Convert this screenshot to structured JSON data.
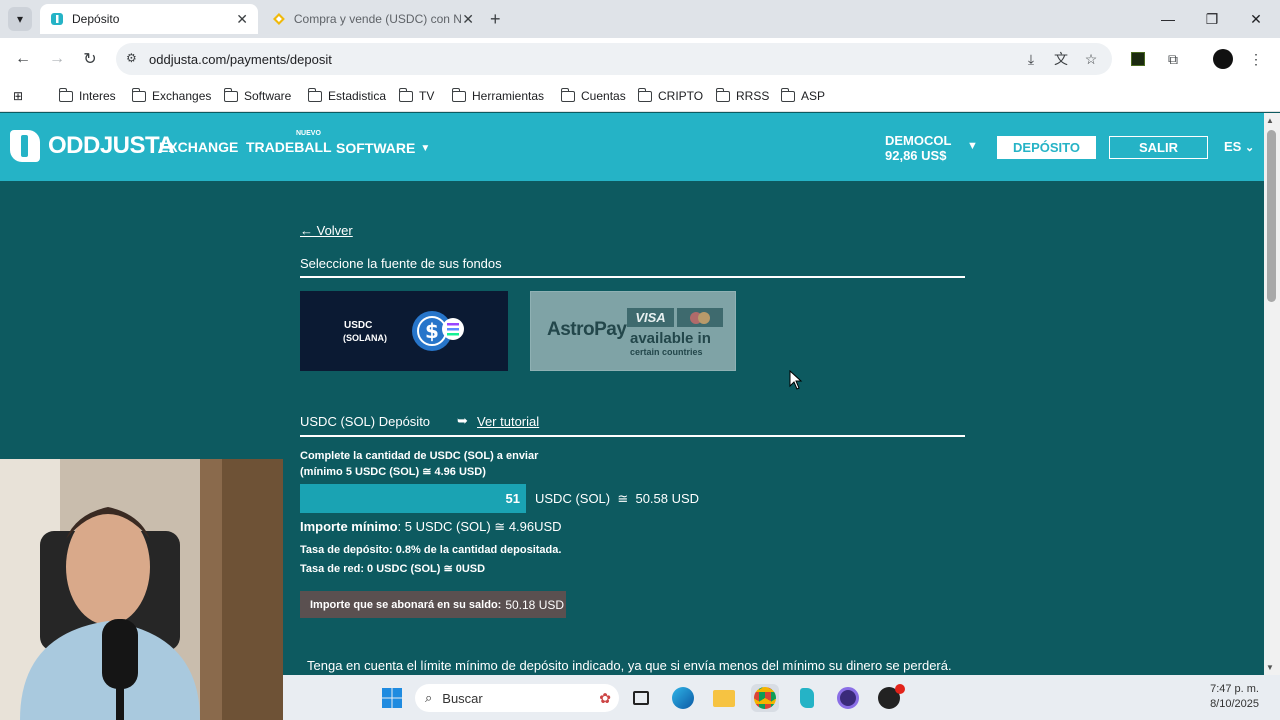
{
  "browser": {
    "tabs": [
      {
        "title": "Depósito"
      },
      {
        "title": "Compra y vende (USDC) con N..."
      }
    ],
    "url": "oddjusta.com/payments/deposit",
    "bookmarks": [
      "Interes",
      "Exchanges",
      "Software",
      "Estadistica",
      "TV",
      "Herramientas",
      "Cuentas",
      "CRIPTO",
      "RRSS",
      "ASP"
    ]
  },
  "header": {
    "logo": "ODDJUSTA",
    "nav": {
      "exchange": "EXCHANGE",
      "tradeball": "TRADEBALL",
      "new_badge": "NUEVO",
      "software": "SOFTWARE"
    },
    "account": {
      "name": "DEMOCOL",
      "balance": "92,86 US$"
    },
    "deposit_button": "DEPÓSITO",
    "logout_button": "SALIR",
    "language": "ES"
  },
  "content": {
    "back": "← Volver",
    "select_source": "Seleccione la fuente de sus fondos",
    "methods": {
      "usdc_line1": "USDC",
      "usdc_line2": "(SOLANA)",
      "astro_brand": "AstroPay",
      "astro_visa": "VISA",
      "astro_avail1": "available in",
      "astro_avail2": "certain countries"
    },
    "deposit_title": "USDC (SOL) Depósito",
    "tutorial_arrow": "➥",
    "tutorial_link": "Ver tutorial",
    "instruction_line1": "Complete la cantidad de USDC (SOL) a enviar",
    "instruction_line2": "(mínimo 5 USDC (SOL) ≅ 4.96 USD)",
    "amount_value": "51",
    "amount_conversion": "USDC (SOL)  ≅  50.58 USD",
    "min_label": "Importe mínimo",
    "min_value": ": 5 USDC (SOL) ≅ 4.96USD",
    "fee_label": "Tasa de depósito:",
    "fee_value": " 0.8% de la cantidad depositada.",
    "network_label": "Tasa de red:",
    "network_value": " 0 USDC (SOL) ≅ 0USD",
    "credited_label": "Importe que se abonará en su saldo:",
    "credited_value": "50.18 USD",
    "warning": "Tenga en cuenta el límite mínimo de depósito indicado, ya que si envía menos del mínimo su dinero se perderá."
  },
  "taskbar": {
    "search_placeholder": "Buscar",
    "time": "7:47 p. m.",
    "date": "8/10/2025"
  },
  "colors": {
    "page_bg": "#0d5a60",
    "header_bg": "#25b3c6",
    "input_bg": "#1aa3b3",
    "credit_bg": "#5a5050"
  }
}
